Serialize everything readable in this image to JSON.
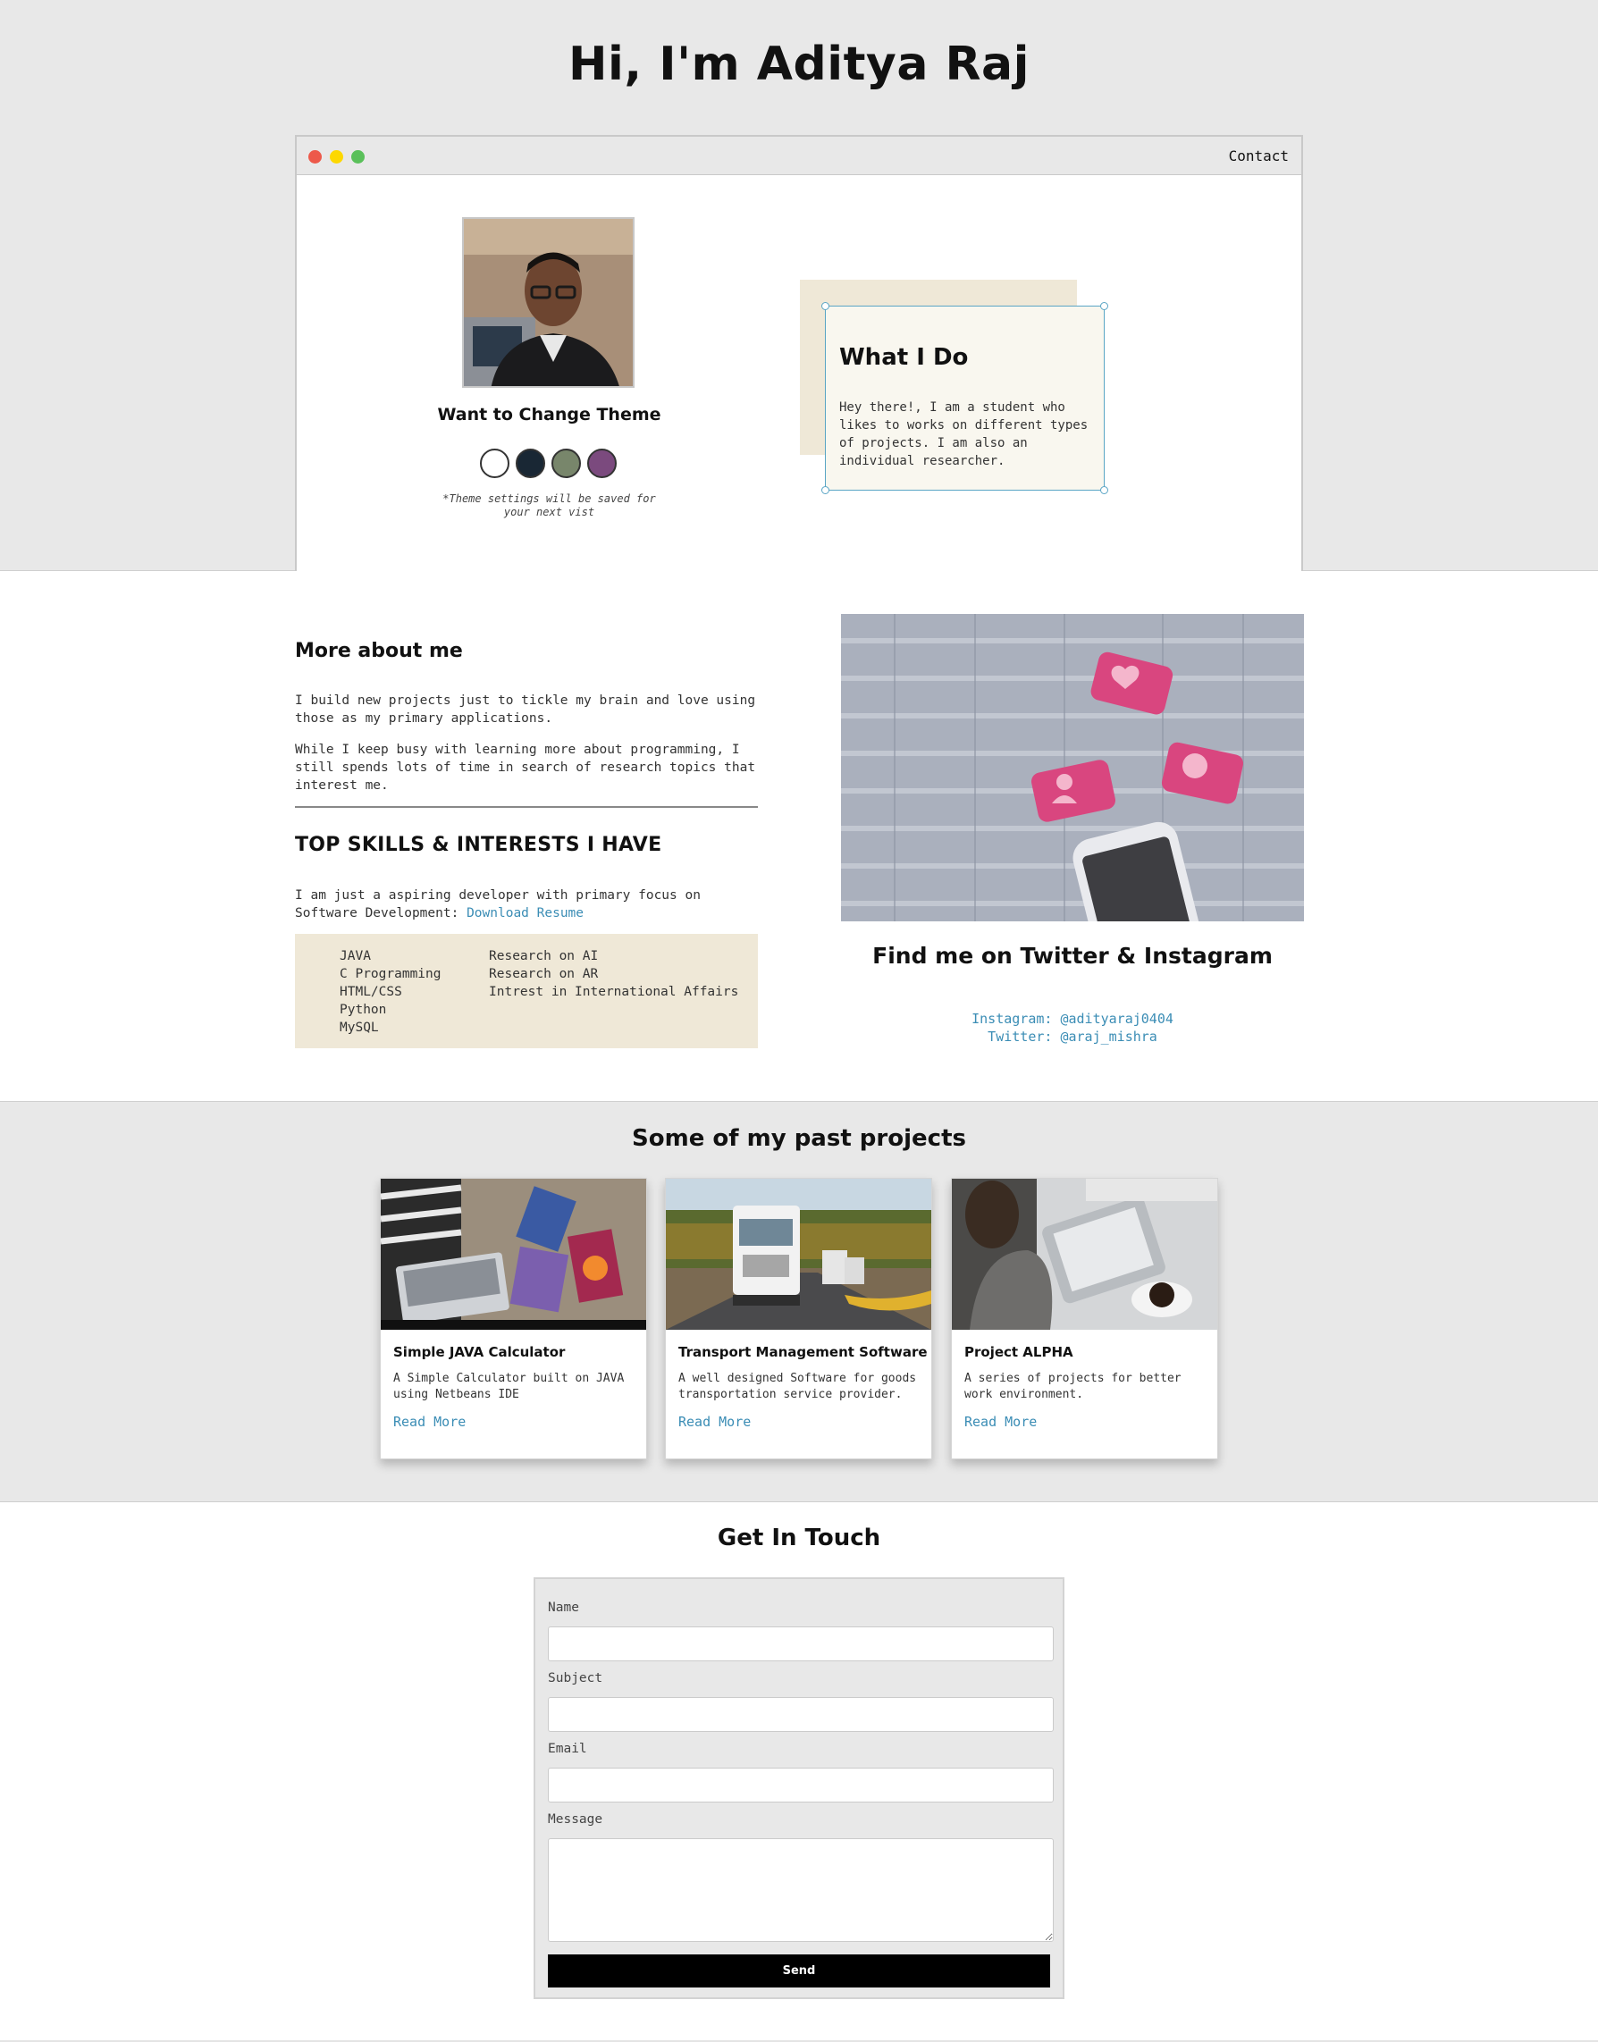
{
  "greeting": {
    "title": "Hi, I'm Aditya Raj"
  },
  "browser": {
    "contact_link": "Contact"
  },
  "profile": {
    "theme_title": "Want to Change Theme",
    "theme_note": "*Theme settings will be saved for your next vist",
    "theme_colors": {
      "light": "#ffffff",
      "blue": "#192734",
      "green": "#78866b",
      "purple": "#7b4a7e"
    }
  },
  "intro": {
    "title": "What I Do",
    "text": "Hey there!, I am a student who likes to works on different types of projects. I am also an individual researcher."
  },
  "about": {
    "title": "More about me",
    "paragraph_1": "I build new projects just to tickle my brain and love using those as my primary applications.",
    "paragraph_2": "While I keep busy with learning more about programming, I still spends lots of time in search of research topics that interest me.",
    "skills_title": "TOP SKILLS & INTERESTS I HAVE",
    "skills_intro": "I am just a aspiring developer with primary focus on Software Development: ",
    "resume_link": "Download Resume",
    "skills": [
      "JAVA",
      "C Programming",
      "HTML/CSS",
      "Python",
      "MySQL"
    ],
    "interests": [
      "Research on AI",
      "Research on AR",
      "Intrest in International Affairs"
    ]
  },
  "social": {
    "title": "Find me on Twitter & Instagram",
    "instagram": "Instagram: @adityaraj0404",
    "twitter": "Twitter: @araj_mishra"
  },
  "projects": {
    "title": "Some of my past projects",
    "cards": [
      {
        "title": "Simple JAVA Calculator",
        "desc": "A Simple Calculator built on JAVA using Netbeans IDE",
        "link": "Read More"
      },
      {
        "title": "Transport Management Software",
        "desc": "A well designed Software for goods transportation service provider.",
        "link": "Read More"
      },
      {
        "title": "Project ALPHA",
        "desc": "A series of projects for better work environment.",
        "link": "Read More"
      }
    ]
  },
  "contact": {
    "title": "Get In Touch",
    "name_label": "Name",
    "subject_label": "Subject",
    "email_label": "Email",
    "message_label": "Message",
    "send_label": "Send"
  },
  "colors": {
    "accent_link": "#3b8db5",
    "section_bg": "#e8e8e8",
    "highlight_bg": "#efe8d7"
  }
}
